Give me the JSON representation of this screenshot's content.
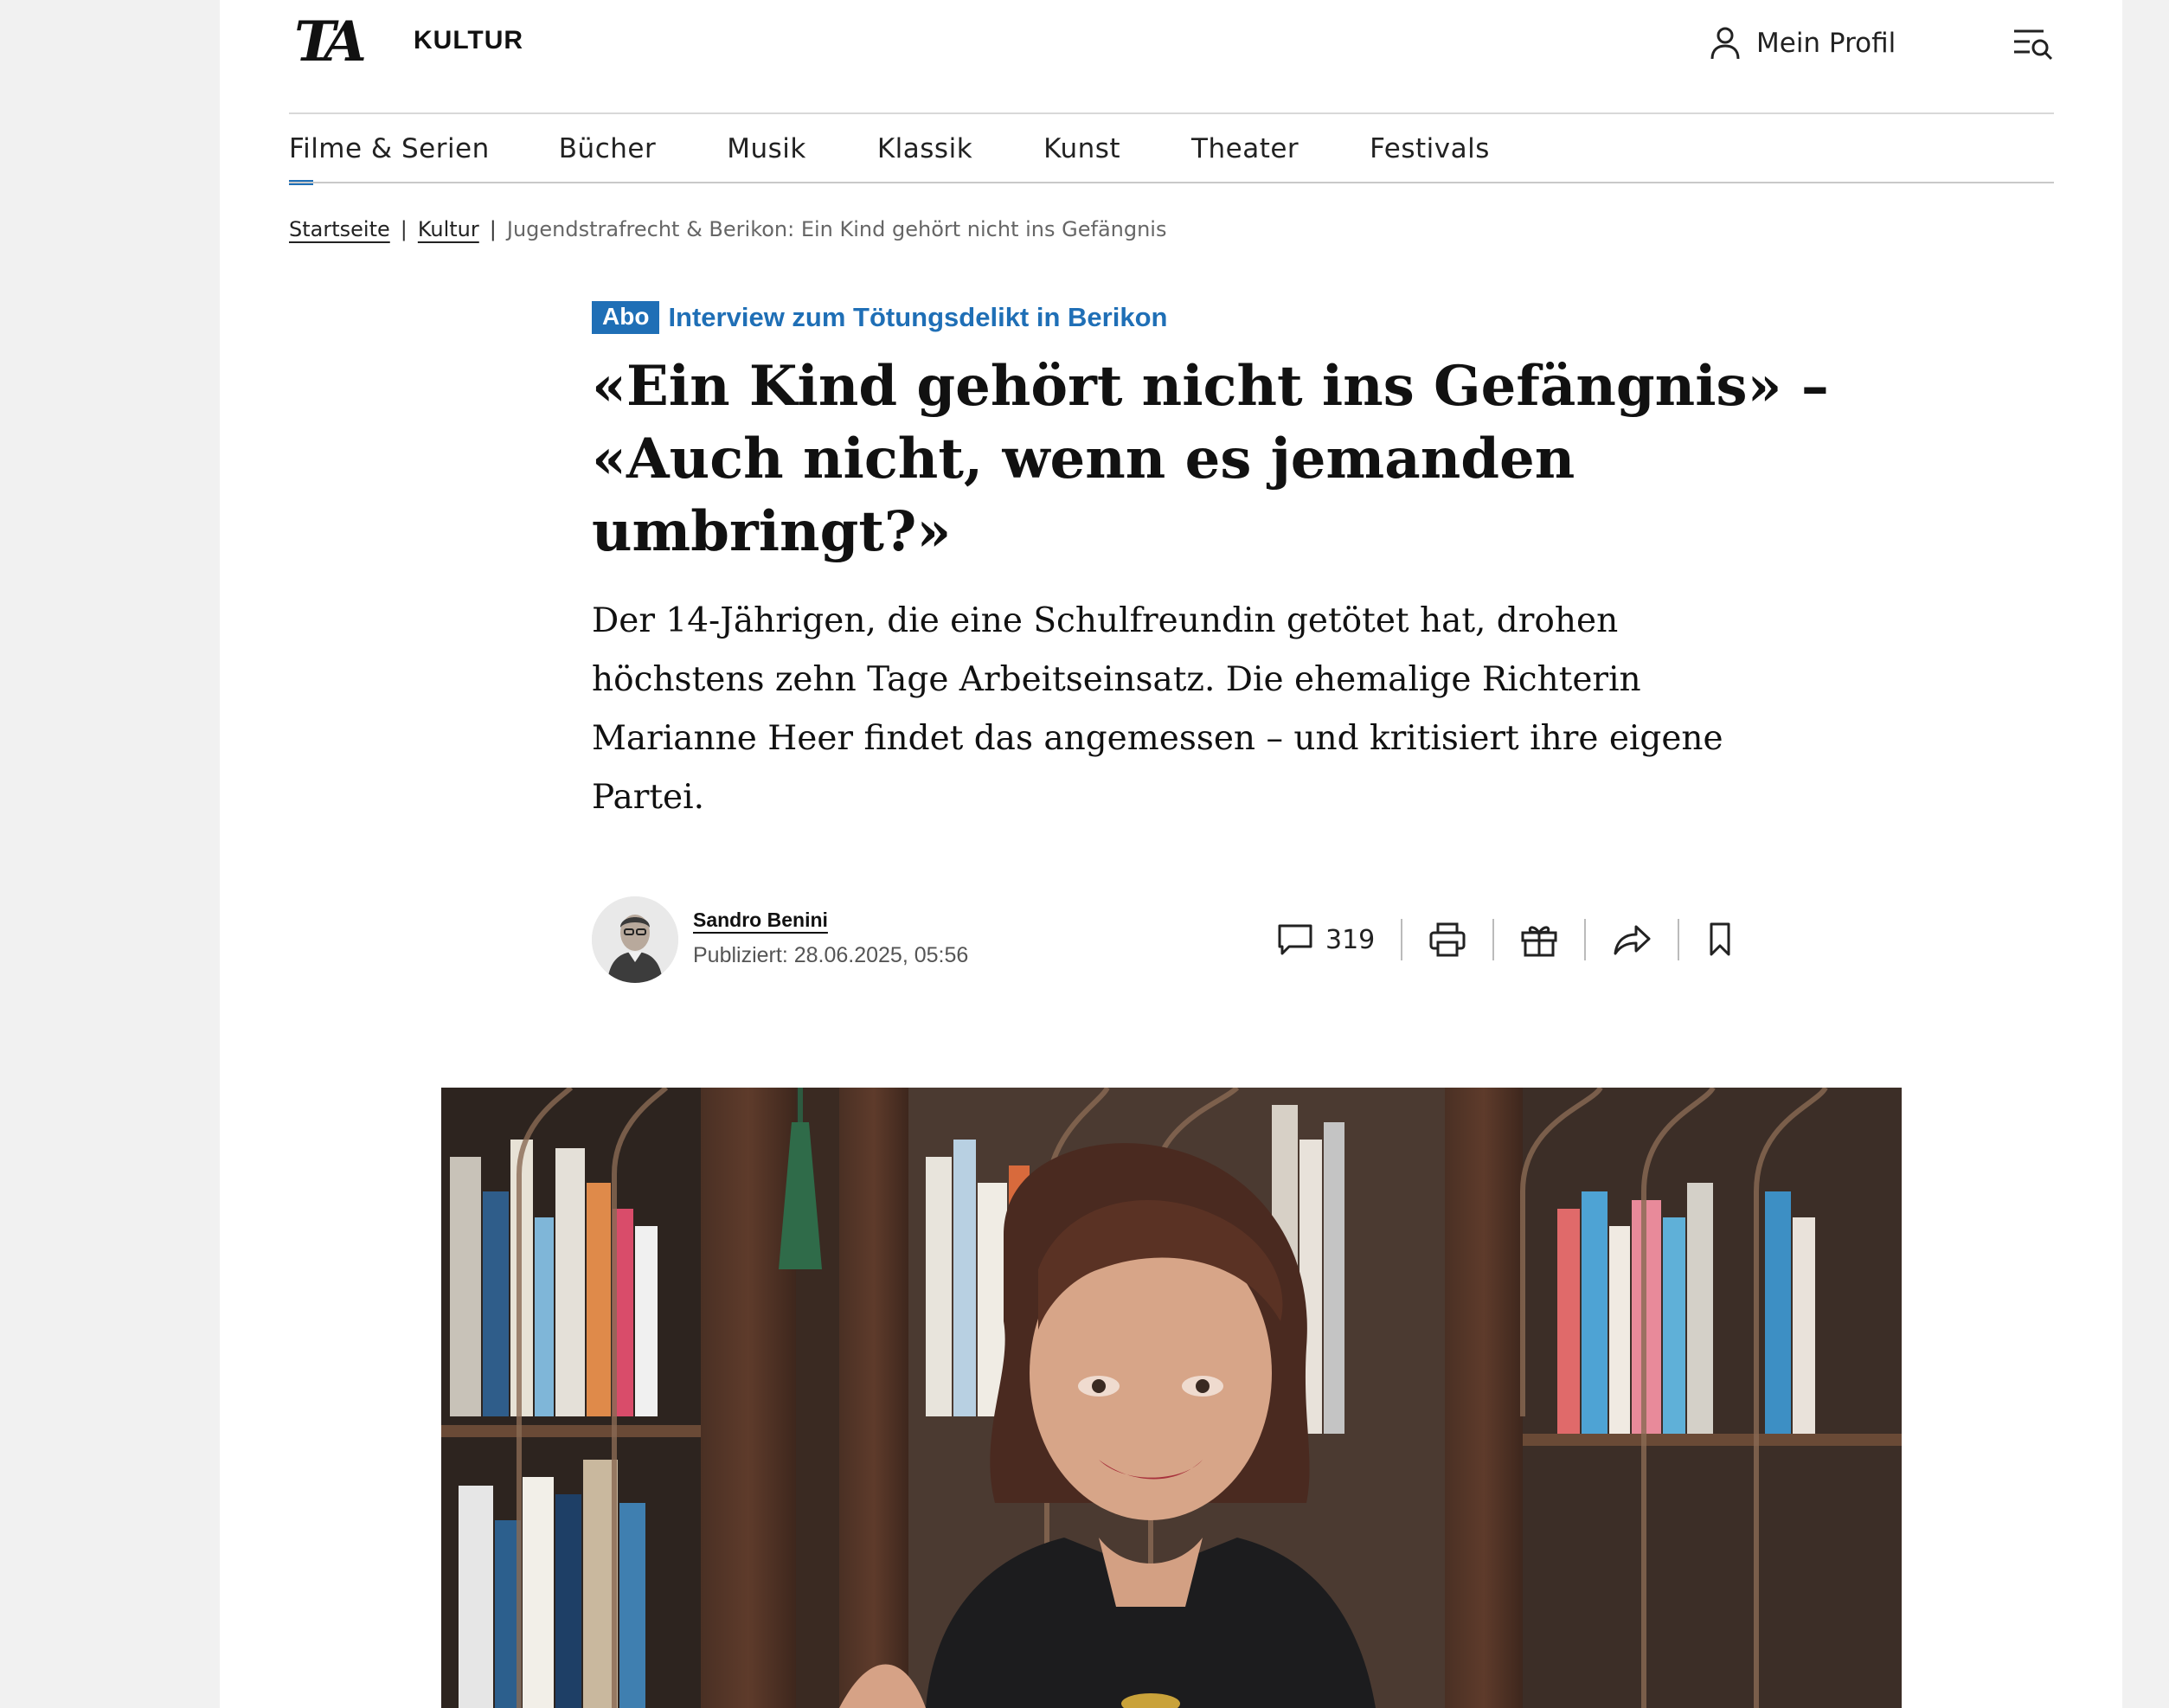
{
  "header": {
    "logo_text": "TA",
    "section": "KULTUR",
    "profile_label": "Mein Profil",
    "profile_icon": "user-icon",
    "menu_icon": "menu-search-icon"
  },
  "nav": {
    "items": [
      {
        "label": "Filme & Serien",
        "active": true
      },
      {
        "label": "Bücher"
      },
      {
        "label": "Musik"
      },
      {
        "label": "Klassik"
      },
      {
        "label": "Kunst"
      },
      {
        "label": "Theater"
      },
      {
        "label": "Festivals"
      }
    ]
  },
  "breadcrumb": {
    "home": "Startseite",
    "section": "Kultur",
    "separator": "|",
    "current": "Jugendstrafrecht & Berikon: Ein Kind gehört nicht ins Gefängnis"
  },
  "article": {
    "badge": "Abo",
    "kicker": "Interview zum Tötungsdelikt in Berikon",
    "headline_1": "«Ein Kind gehört nicht ins Gefängnis» –",
    "headline_2": "«Auch nicht, wenn es jemanden",
    "headline_3": "umbringt?»",
    "lead_1": "Der 14-Jährigen, die eine Schulfreundin getötet hat, drohen",
    "lead_2": "höchstens zehn Tage Arbeitseinsatz. Die ehemalige Richterin",
    "lead_3": "Marianne Heer findet das angemessen – und kritisiert ihre eigene",
    "lead_4": "Partei.",
    "author": "Sandro Benini",
    "published": "Publiziert: 28.06.2025, 05:56",
    "comment_count": "319"
  },
  "actions": {
    "icons": [
      "comment-icon",
      "print-icon",
      "gift-icon",
      "share-icon",
      "bookmark-icon"
    ]
  },
  "colors": {
    "accent": "#1f6fb6",
    "background": "#f1f1f1",
    "page": "#ffffff"
  }
}
